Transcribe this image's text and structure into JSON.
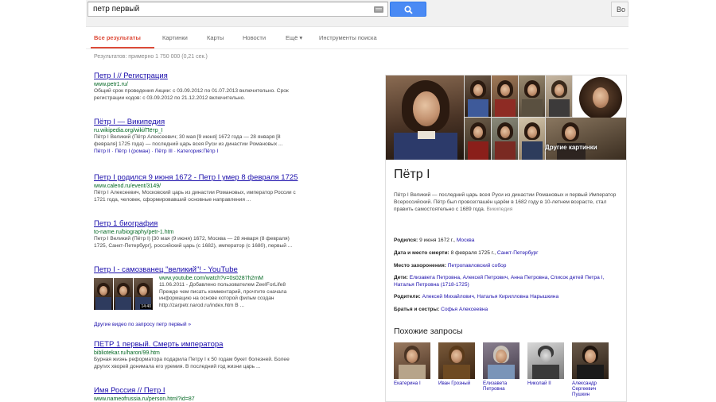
{
  "search": {
    "query": "петр первый",
    "right_button": "Во"
  },
  "tabs": [
    {
      "label": "Все результаты",
      "active": true
    },
    {
      "label": "Картинки"
    },
    {
      "label": "Карты"
    },
    {
      "label": "Новости"
    },
    {
      "label": "Ещё ▾"
    },
    {
      "label": "Инструменты поиска"
    }
  ],
  "stats": "Результатов: примерно 1 750 000 (0,21 сек.)",
  "results": [
    {
      "title": "Петр I // Регистрация",
      "url": "www.petr1.ru/",
      "snippet": [
        "Общий срок проведения Акции: с 03.09.2012 по 01.07.2013 включительно. Срок",
        "регистрации кодов: с 03.09.2012 по 21.12.2012 включительно."
      ]
    },
    {
      "title": "Пётр I — Википедия",
      "url": "ru.wikipedia.org/wiki/Пётр_I",
      "snippet": [
        "Пётр I Великий (Пётр Алексеевич; 30 мая [9 июня] 1672 года — 28 января [8",
        "февраля] 1725 года) — последний царь всея Руси из династии Романовых ..."
      ],
      "sublinks": "Пётр II · Пётр I (роман) · Пётр III · Категория:Пётр I"
    },
    {
      "title": "Петр I родился 9 июня 1672 - Петр I умер 8 февраля 1725",
      "url": "www.calend.ru/event/3149/",
      "snippet": [
        "Пётр I Алексеевич, Московский царь из династии Романовых, император России с",
        "1721 года, человек, сформировавший основные направления ..."
      ]
    },
    {
      "title": "Петр 1 биография",
      "url": "to-name.ru/biography/petr-1.htm",
      "snippet": [
        "Петр I Великий (Пётр I) [30 мая (9 июня) 1672, Москва — 28 января (8 февраля)",
        "1725, Санкт-Петербург], российский царь (с 1682), император (с 1680), первый ..."
      ]
    },
    {
      "title": "Петр I - самозванец \"великий\"! - YouTube",
      "url": "www.youtube.com/watch?v=0s0287h2mM",
      "snippet": [
        "11.06.2011 - Добавлено пользователем ZeeIForLife8",
        "Прежде чем писать комментарий, прочтите сначала",
        "информацию на основе которой фильм создан",
        "http://zarpetr.narod.ru/index.htm В ..."
      ],
      "video_time": "14:40",
      "more_videos": "Другие видео по запросу петр первый »"
    },
    {
      "title": "ПЕТР 1 первый. Смерть императора",
      "url": "bibliotekar.ru/haron/99.htm",
      "snippet": [
        "Бурная жизнь реформатора подарила Петру I к 50 годам букет болезней. Более",
        "других хворей донимала его уремия. В последний год жизни царь ..."
      ]
    },
    {
      "title": "Имя Россия // Петр I",
      "url": "www.nameofrussia.ru/person.html?id=87"
    }
  ],
  "knowledge_panel": {
    "more_images": "Другие картинки",
    "title": "Пётр I",
    "description": "Пётр I Великий — последний царь всея Руси из династии Романовых и первый Император Всероссийский. Пётр был провозглашён царём в 1682 году в 10-летнем возрасте, стал править самостоятельно с 1689 года.",
    "source": "Википедия",
    "facts": [
      {
        "label": "Родился:",
        "value": "9 июня 1672 г., ",
        "link": "Москва"
      },
      {
        "label": "Дата и место смерти:",
        "value": "8 февраля 1725 г., ",
        "link": "Санкт-Петербург"
      },
      {
        "label": "Место захоронения:",
        "value": "",
        "link": "Петропавловский собор"
      },
      {
        "label": "Дети:",
        "value": "",
        "link": "Елизавета Петровна, Алексей Петрович, Анна Петровна, Список детей Петра I, Наталья Петровна (1718-1725)"
      },
      {
        "label": "Родители:",
        "value": "",
        "link": "Алексей Михайлович, Наталья Кирилловна Нарышкина"
      },
      {
        "label": "Братья и сестры:",
        "value": "",
        "link": "Софья Алексеевна"
      }
    ],
    "related_title": "Похожие запросы",
    "related": [
      {
        "label": "Екатерина I"
      },
      {
        "label": "Иван Грозный"
      },
      {
        "label": "Елизавета Петровна"
      },
      {
        "label": "Николай II"
      },
      {
        "label": "Александр Сергеевич Пушкин"
      }
    ]
  }
}
